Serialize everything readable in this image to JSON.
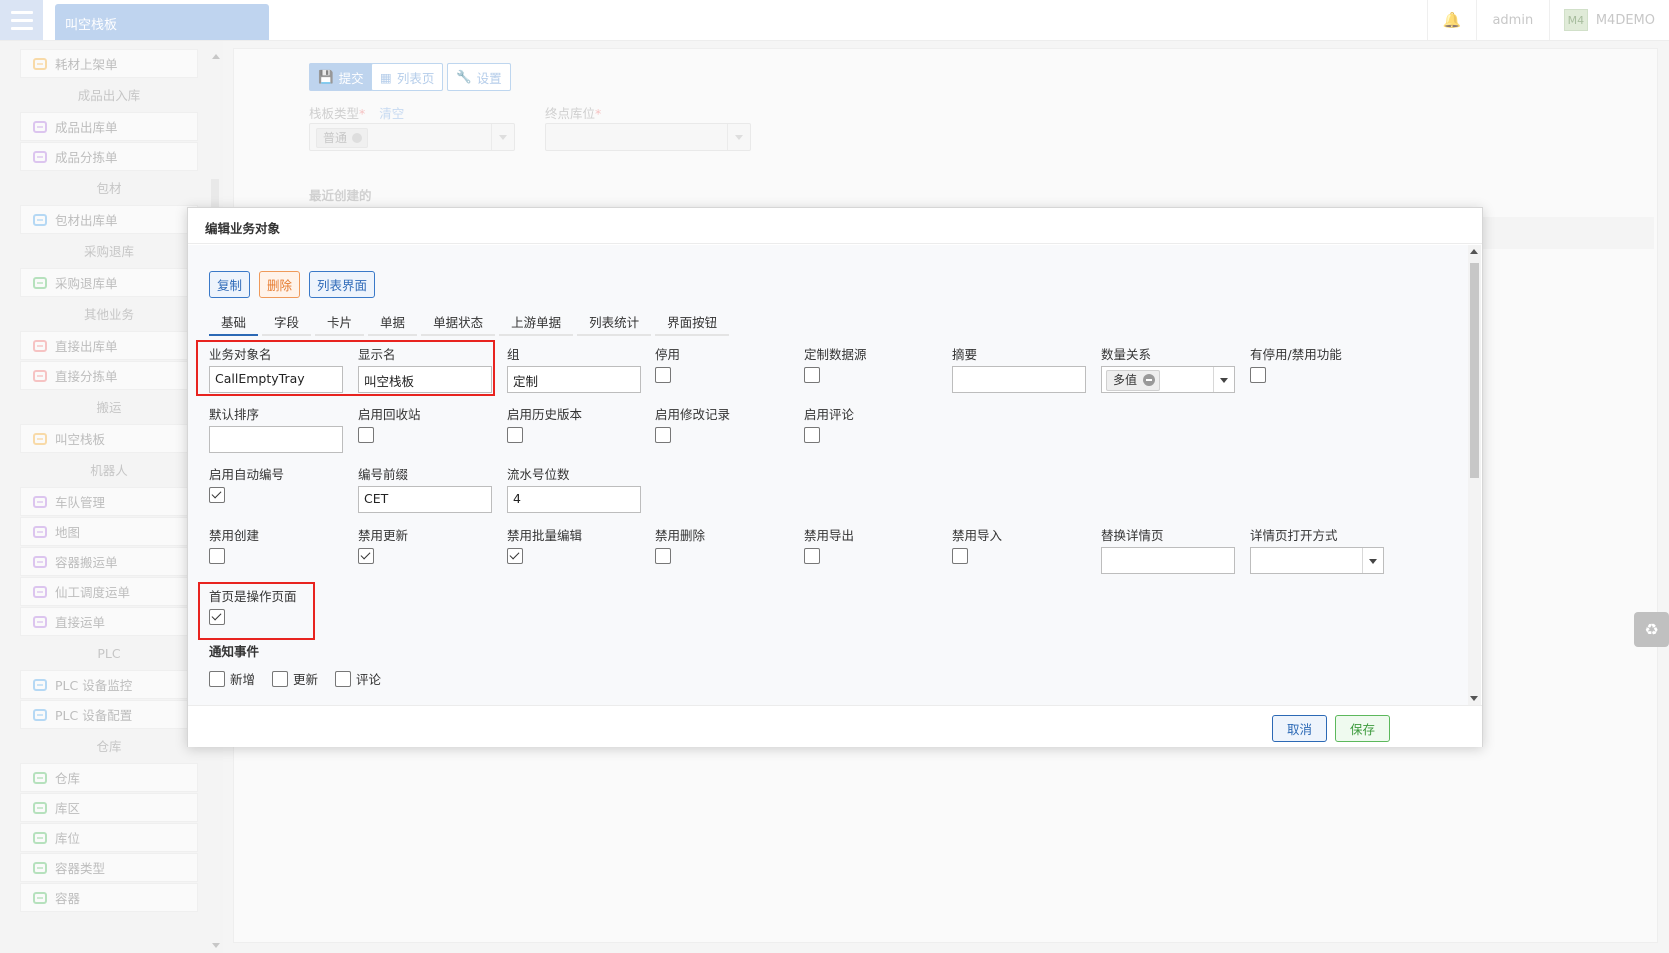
{
  "topbar": {
    "tab_title": "叫空栈板",
    "user": "admin",
    "logo_text": "M4",
    "app_name": "M4DEMO"
  },
  "sidebar": {
    "sections": [
      {
        "group": "",
        "items": [
          {
            "label": "耗材上架单",
            "color": "#f5c67a"
          }
        ]
      },
      {
        "group": "成品出入库",
        "items": [
          {
            "label": "成品出库单",
            "color": "#c9a6e6"
          },
          {
            "label": "成品分拣单",
            "color": "#c9a6e6"
          }
        ]
      },
      {
        "group": "包材",
        "items": [
          {
            "label": "包材出库单",
            "color": "#8ec4ee"
          }
        ]
      },
      {
        "group": "采购退库",
        "items": [
          {
            "label": "采购退库单",
            "color": "#8fd29a"
          }
        ]
      },
      {
        "group": "其他业务",
        "items": [
          {
            "label": "直接出库单",
            "color": "#f2a3a3"
          },
          {
            "label": "直接分拣单",
            "color": "#f2a3a3"
          }
        ]
      },
      {
        "group": "搬运",
        "items": [
          {
            "label": "叫空栈板",
            "color": "#f5c67a"
          }
        ]
      },
      {
        "group": "机器人",
        "items": [
          {
            "label": "车队管理",
            "color": "#c9a6e6"
          },
          {
            "label": "地图",
            "color": "#c9a6e6"
          },
          {
            "label": "容器搬运单",
            "color": "#c9a6e6"
          },
          {
            "label": "仙工调度运单",
            "color": "#c9a6e6"
          },
          {
            "label": "直接运单",
            "color": "#c9a6e6"
          }
        ]
      },
      {
        "group": "PLC",
        "items": [
          {
            "label": "PLC 设备监控",
            "color": "#8ec4ee"
          },
          {
            "label": "PLC 设备配置",
            "color": "#8ec4ee"
          }
        ]
      },
      {
        "group": "仓库",
        "items": [
          {
            "label": "仓库",
            "color": "#8fd29a"
          },
          {
            "label": "库区",
            "color": "#8fd29a"
          },
          {
            "label": "库位",
            "color": "#8fd29a"
          },
          {
            "label": "容器类型",
            "color": "#8fd29a"
          },
          {
            "label": "容器",
            "color": "#8fd29a"
          }
        ]
      }
    ]
  },
  "background_page": {
    "toolbar": {
      "submit": "提交",
      "list": "列表页",
      "settings": "设置"
    },
    "tray_type_label": "栈板类型",
    "clear_link": "清空",
    "tray_type_value": "普通",
    "end_location_label": "终点库位",
    "recent_label": "最近创建的"
  },
  "modal": {
    "title": "编辑业务对象",
    "actions": {
      "copy": "复制",
      "delete": "删除",
      "list_ui": "列表界面"
    },
    "tabs": [
      "基础",
      "字段",
      "卡片",
      "单据",
      "单据状态",
      "上游单据",
      "列表统计",
      "界面按钮"
    ],
    "fields": {
      "object_name": {
        "label": "业务对象名",
        "value": "CallEmptyTray"
      },
      "display_name": {
        "label": "显示名",
        "value": "叫空栈板"
      },
      "group": {
        "label": "组",
        "value": "定制"
      },
      "disabled": {
        "label": "停用",
        "checked": false
      },
      "custom_datasource": {
        "label": "定制数据源",
        "checked": false
      },
      "summary": {
        "label": "摘要",
        "value": ""
      },
      "quantity_relation": {
        "label": "数量关系",
        "value": "多值"
      },
      "has_disable_feature": {
        "label": "有停用/禁用功能",
        "checked": false
      },
      "default_sort": {
        "label": "默认排序",
        "value": ""
      },
      "enable_recycle": {
        "label": "启用回收站",
        "checked": false
      },
      "enable_history": {
        "label": "启用历史版本",
        "checked": false
      },
      "enable_change_log": {
        "label": "启用修改记录",
        "checked": false
      },
      "enable_comments": {
        "label": "启用评论",
        "checked": false
      },
      "enable_auto_number": {
        "label": "启用自动编号",
        "checked": true
      },
      "number_prefix": {
        "label": "编号前缀",
        "value": "CET"
      },
      "serial_digits": {
        "label": "流水号位数",
        "value": "4"
      },
      "disable_create": {
        "label": "禁用创建",
        "checked": false
      },
      "disable_update": {
        "label": "禁用更新",
        "checked": true
      },
      "disable_batch_edit": {
        "label": "禁用批量编辑",
        "checked": true
      },
      "disable_delete": {
        "label": "禁用删除",
        "checked": false
      },
      "disable_export": {
        "label": "禁用导出",
        "checked": false
      },
      "disable_import": {
        "label": "禁用导入",
        "checked": false
      },
      "replace_detail_page": {
        "label": "替换详情页",
        "value": ""
      },
      "detail_open_mode": {
        "label": "详情页打开方式",
        "value": ""
      },
      "home_is_action_page": {
        "label": "首页是操作页面",
        "checked": true
      }
    },
    "notify": {
      "title": "通知事件",
      "events": [
        {
          "label": "新增",
          "checked": false
        },
        {
          "label": "更新",
          "checked": false
        },
        {
          "label": "评论",
          "checked": false
        }
      ]
    },
    "footer": {
      "cancel": "取消",
      "save": "保存"
    }
  },
  "colors": {
    "accent": "#2c69b5",
    "highlight": "#e8231f",
    "save": "#5cb85c",
    "delete": "#ef9a5a"
  }
}
